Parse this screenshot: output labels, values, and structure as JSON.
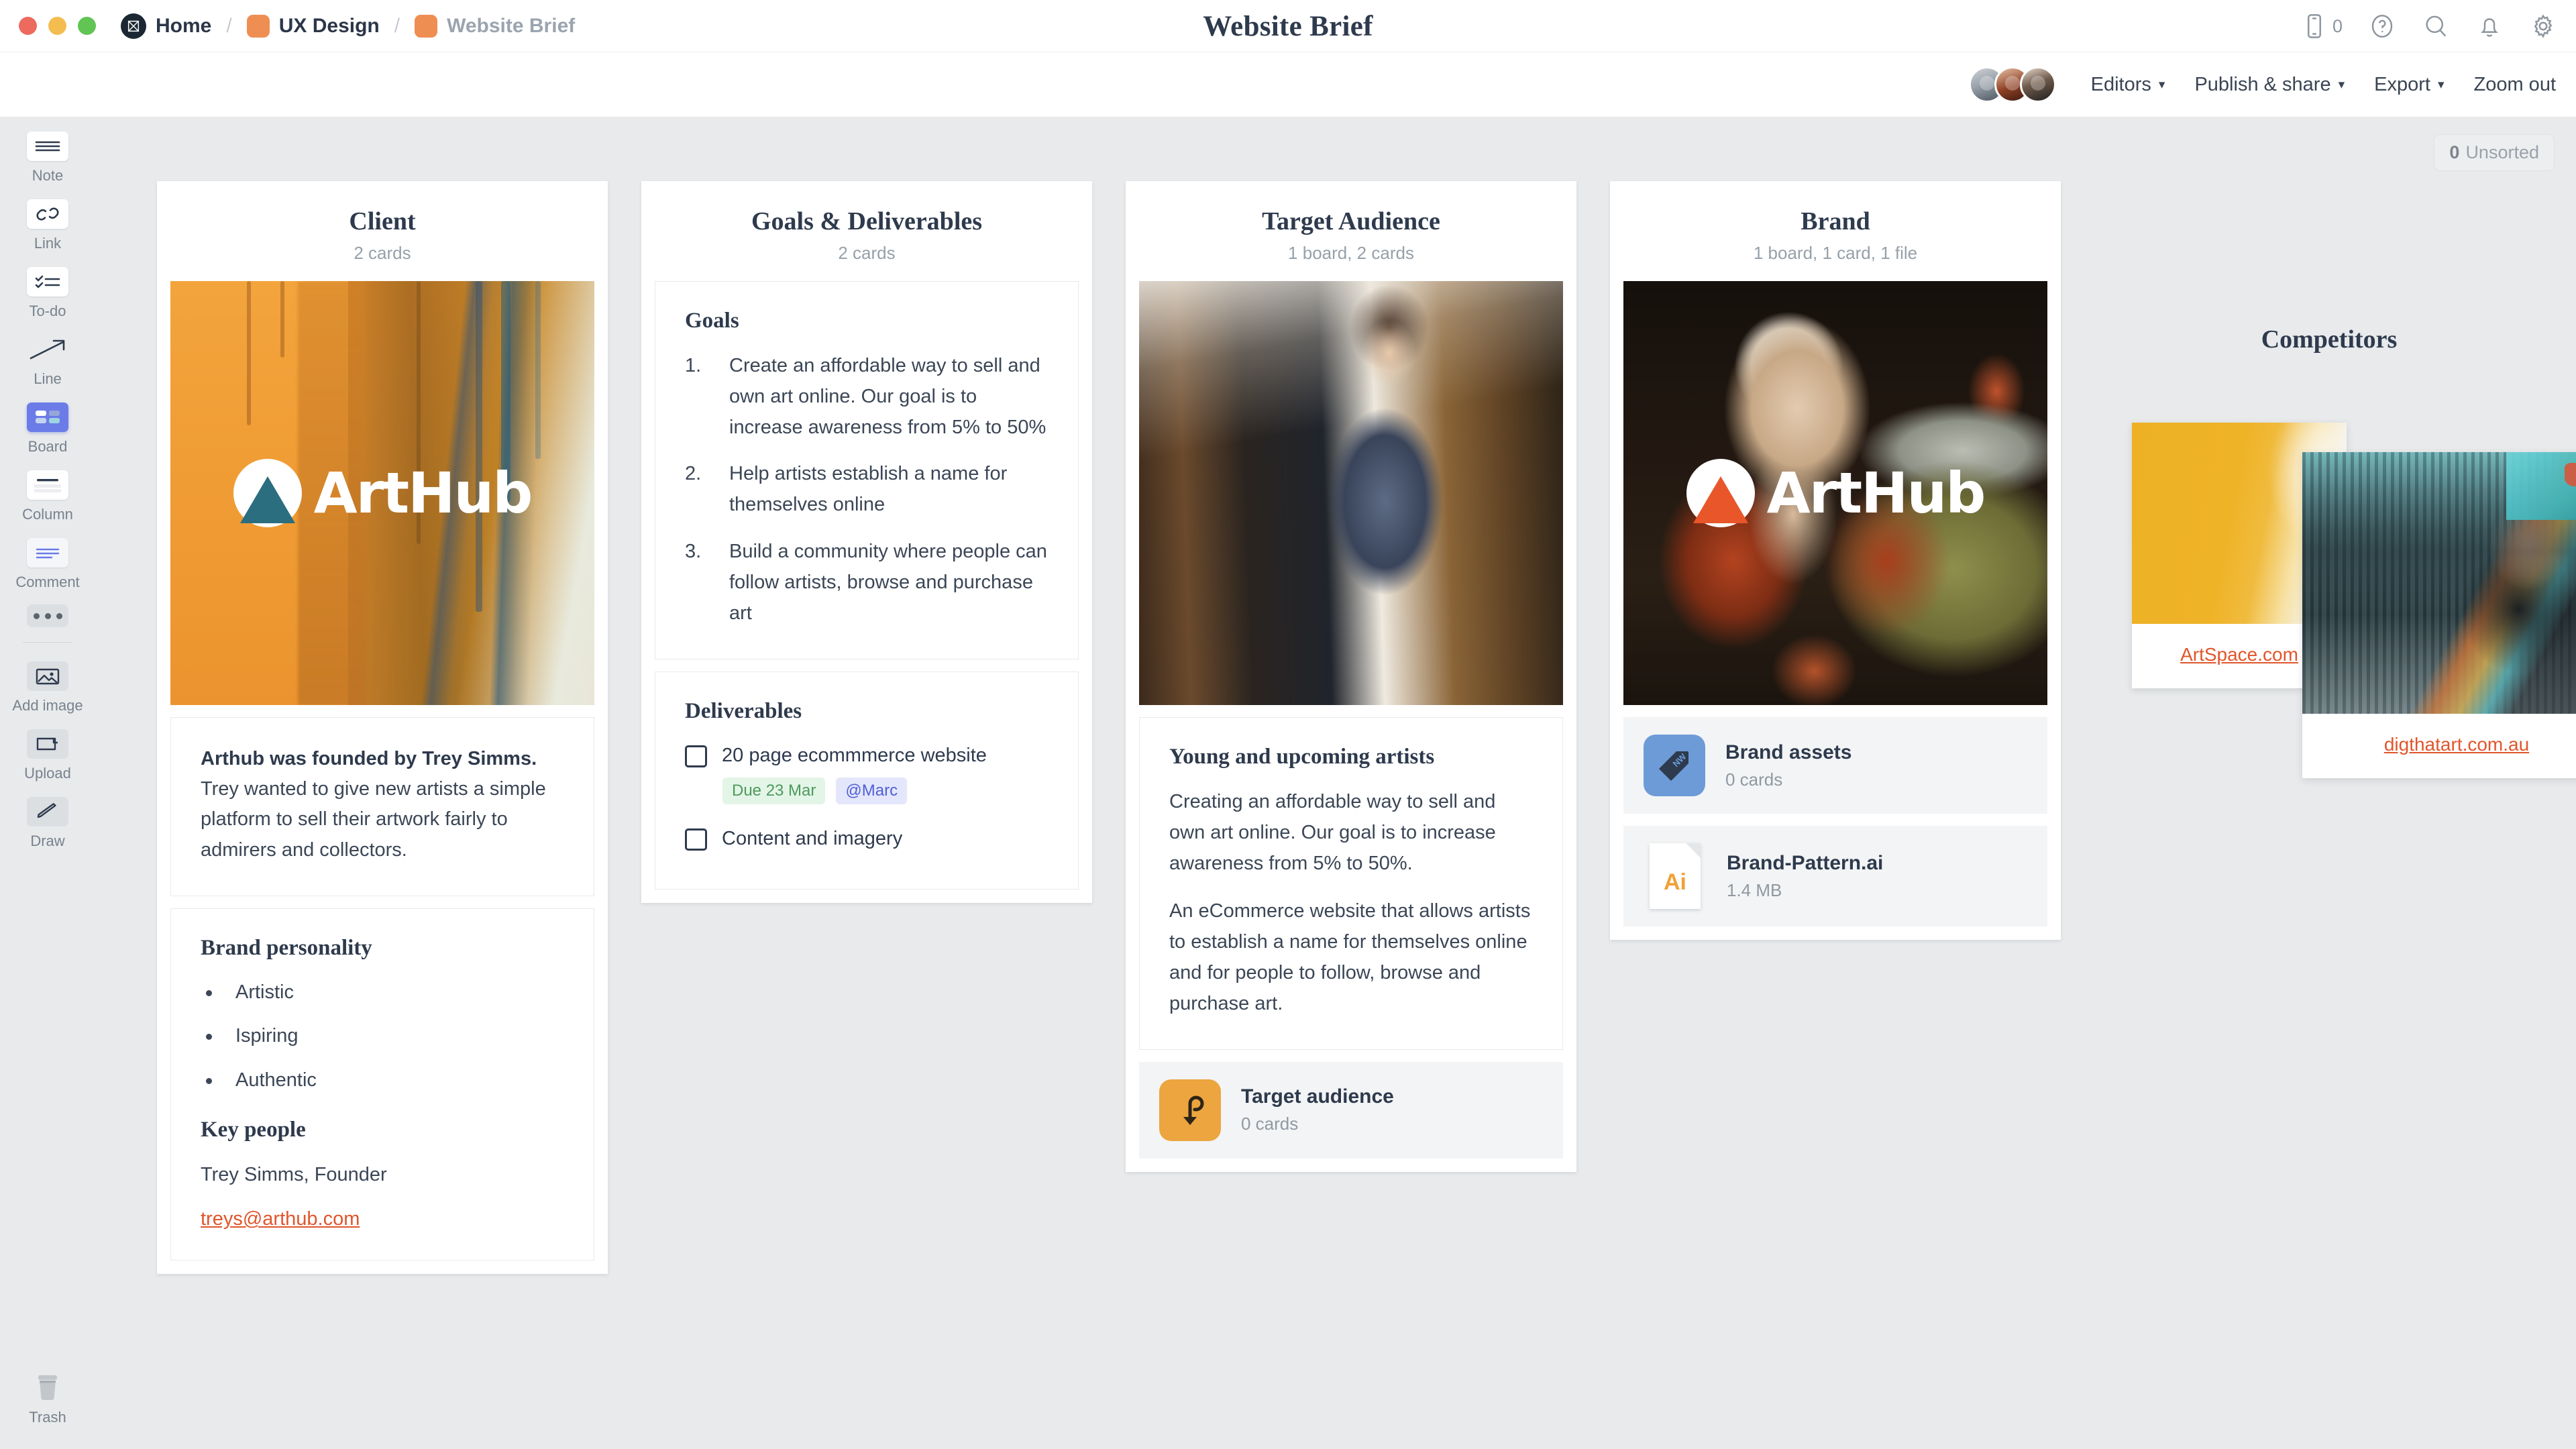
{
  "window": {
    "dots": [
      "close",
      "minimize",
      "maximize"
    ]
  },
  "breadcrumb": {
    "items": [
      {
        "label": "Home",
        "type": "logo"
      },
      {
        "label": "UX Design",
        "type": "square"
      },
      {
        "label": "Website Brief",
        "type": "square",
        "muted": true
      }
    ],
    "separator": "/"
  },
  "header": {
    "title": "Website Brief"
  },
  "topbar_icons": {
    "phone_count": "0",
    "help": "help-circle-icon",
    "search": "search-icon",
    "notifications": "bell-icon",
    "settings": "gear-icon"
  },
  "toolbar": {
    "editors_label": "Editors",
    "publish_label": "Publish & share",
    "export_label": "Export",
    "zoom_out_label": "Zoom out",
    "caret": "⌄"
  },
  "sidebar": {
    "tools": [
      {
        "label": "Note",
        "icon": "note-icon",
        "active": false
      },
      {
        "label": "Link",
        "icon": "link-icon",
        "active": false
      },
      {
        "label": "To-do",
        "icon": "todo-icon",
        "active": false
      },
      {
        "label": "Line",
        "icon": "line-icon",
        "active": false
      },
      {
        "label": "Board",
        "icon": "board-icon",
        "active": true
      },
      {
        "label": "Column",
        "icon": "column-icon",
        "active": false
      },
      {
        "label": "Comment",
        "icon": "comment-icon",
        "active": false
      }
    ],
    "more_label": "more-options",
    "uploads": [
      {
        "label": "Add image",
        "icon": "image-icon"
      },
      {
        "label": "Upload",
        "icon": "upload-icon"
      },
      {
        "label": "Draw",
        "icon": "pencil-icon"
      }
    ],
    "trash": {
      "label": "Trash",
      "icon": "trash-icon"
    }
  },
  "canvas": {
    "unsorted": {
      "count": "0",
      "label": "Unsorted"
    }
  },
  "columns": [
    {
      "title": "Client",
      "subtitle": "2 cards",
      "hero": {
        "type": "paint-splatter",
        "logo_text": "ArtHub",
        "logo_color": "#2a6e7f"
      },
      "cards": [
        {
          "type": "text",
          "strong": "Arthub was founded by Trey Simms.",
          "body": "Trey wanted to give new artists a simple platform to sell their artwork fairly to admirers and collectors."
        },
        {
          "type": "rich",
          "heading": "Brand personality",
          "bullets": [
            "Artistic",
            "Ispiring",
            "Authentic"
          ],
          "heading2": "Key people",
          "person": "Trey Simms, Founder",
          "email": "treys@arthub.com"
        }
      ]
    },
    {
      "title": "Goals & Deliverables",
      "subtitle": "2 cards",
      "cards": [
        {
          "type": "ordered",
          "heading": "Goals",
          "items": [
            "Create an affordable way to sell and own art online. Our goal is to increase awareness from 5% to 50%",
            "Help artists establish a name for themselves online",
            "Build a community where people can follow artists, browse and purchase art"
          ]
        },
        {
          "type": "todo",
          "heading": "Deliverables",
          "items": [
            {
              "label": "20 page ecommmerce website",
              "checked": false,
              "tags": [
                {
                  "text": "Due 23 Mar",
                  "kind": "due"
                },
                {
                  "text": "@Marc",
                  "kind": "mention"
                }
              ]
            },
            {
              "label": "Content and imagery",
              "checked": false,
              "tags": []
            }
          ]
        }
      ]
    },
    {
      "title": "Target Audience",
      "subtitle": "1 board, 2 cards",
      "hero": {
        "type": "photo-artist-studio"
      },
      "cards": [
        {
          "type": "paragraphs",
          "heading": "Young and upcoming artists",
          "paragraphs": [
            "Creating an affordable way to sell and own art online. Our goal is to increase awareness from 5% to 50%.",
            "An eCommerce website that allows artists to establish a name for themselves online and for people to follow, browse and purchase art."
          ]
        },
        {
          "type": "board-row",
          "icon": "target-audience-icon",
          "icon_color": "#eca53f",
          "title": "Target audience",
          "subtitle": "0 cards"
        }
      ]
    },
    {
      "title": "Brand",
      "subtitle": "1 board, 1 card, 1 file",
      "hero": {
        "type": "painting-old-master",
        "logo_text": "ArtHub",
        "logo_color": "#e8562a"
      },
      "cards": [
        {
          "type": "board-row",
          "icon": "tag-icon",
          "icon_color": "#6d9bd8",
          "title": "Brand assets",
          "subtitle": "0 cards"
        },
        {
          "type": "file-row",
          "ext": "Ai",
          "title": "Brand-Pattern.ai",
          "subtitle": "1.4 MB"
        }
      ]
    }
  ],
  "competitors": {
    "title": "Competitors",
    "cards": [
      {
        "link": "ArtSpace.com",
        "image": "yellow-wall"
      },
      {
        "link": "digthatart.com.au",
        "image": "street-artist"
      }
    ]
  }
}
